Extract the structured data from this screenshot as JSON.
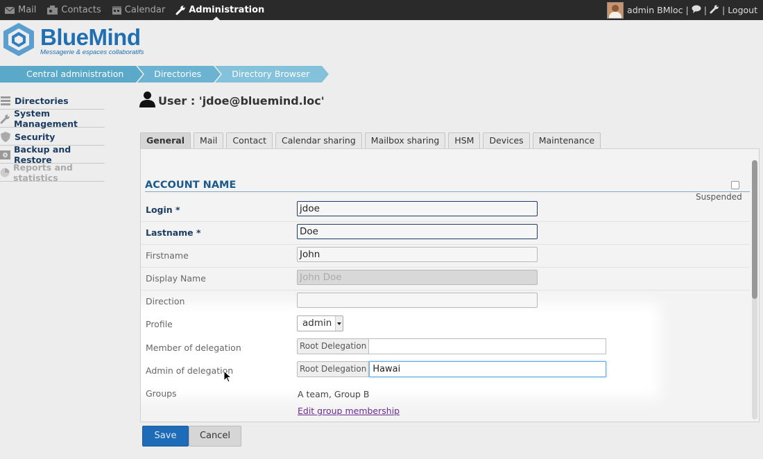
{
  "topbar": {
    "nav": [
      {
        "label": "Mail",
        "icon": "mail-icon"
      },
      {
        "label": "Contacts",
        "icon": "contacts-icon"
      },
      {
        "label": "Calendar",
        "icon": "calendar-icon"
      },
      {
        "label": "Administration",
        "icon": "wrench-icon",
        "active": true
      }
    ],
    "user_label": "admin BMloc",
    "logout_label": "Logout"
  },
  "logo": {
    "name": "BlueMind",
    "tagline": "Messagerie & espaces collaboratifs"
  },
  "breadcrumb": [
    "Central administration",
    "Directories",
    "Directory Browser"
  ],
  "sidebar": {
    "items": [
      {
        "label": "Directories",
        "icon": "directory-icon",
        "disabled": false
      },
      {
        "label": "System Management",
        "icon": "wrench-icon",
        "disabled": false
      },
      {
        "label": "Security",
        "icon": "shield-icon",
        "disabled": false
      },
      {
        "label": "Backup and Restore",
        "icon": "backup-icon",
        "disabled": false
      },
      {
        "label": "Reports and statistics",
        "icon": "chart-icon",
        "disabled": true
      }
    ]
  },
  "page": {
    "title": "User : 'jdoe@bluemind.loc'"
  },
  "tabs": [
    "General",
    "Mail",
    "Contact",
    "Calendar sharing",
    "Mailbox sharing",
    "HSM",
    "Devices",
    "Maintenance"
  ],
  "form": {
    "section_title": "ACCOUNT NAME",
    "suspended_label": "Suspended",
    "login": {
      "label": "Login *",
      "value": "jdoe"
    },
    "lastname": {
      "label": "Lastname *",
      "value": "Doe"
    },
    "firstname": {
      "label": "Firstname",
      "value": "John"
    },
    "display_name": {
      "label": "Display Name",
      "placeholder": "John Doe"
    },
    "direction": {
      "label": "Direction",
      "value": ""
    },
    "profile": {
      "label": "Profile",
      "value": "admin"
    },
    "member_of_delegation": {
      "label": "Member of delegation",
      "prefix": "Root Delegation",
      "value": ""
    },
    "admin_of_delegation": {
      "label": "Admin of delegation",
      "prefix": "Root Delegation",
      "value": "Hawai"
    },
    "groups": {
      "label": "Groups",
      "value": "A team, Group B",
      "link": "Edit group membership"
    }
  },
  "buttons": {
    "save": "Save",
    "cancel": "Cancel"
  },
  "colors": {
    "accent": "#1e6bb8",
    "breadcrumb": "#5aa9c9",
    "heading": "#1c5a8c"
  }
}
